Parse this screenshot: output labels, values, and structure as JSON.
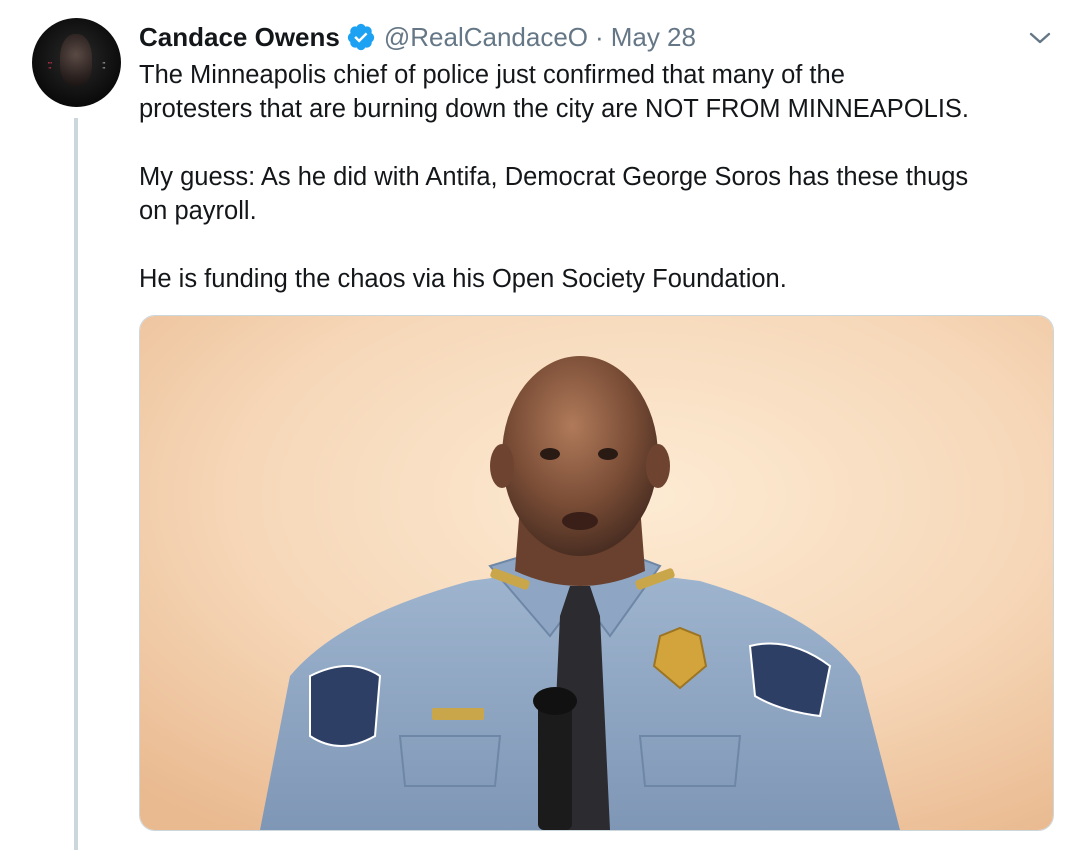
{
  "tweet": {
    "author_name": "Candace Owens",
    "handle": "@RealCandaceO",
    "separator": "·",
    "date": "May 28",
    "paragraphs": [
      "The Minneapolis chief of police just confirmed that many of the\nprotesters that are burning down the city are NOT FROM MINNEAPOLIS.",
      "My guess: As he did with Antifa, Democrat George Soros has these thugs\non payroll.",
      "He is funding the chaos via his Open Society Foundation."
    ]
  },
  "icons": {
    "verified": "verified-badge-icon",
    "caret": "chevron-down-icon"
  },
  "colors": {
    "text_primary": "#14171a",
    "text_secondary": "#657786",
    "verified_blue": "#1da1f2",
    "thread_line": "#ccd6dd",
    "media_border": "#ccd6dd"
  },
  "media": {
    "type": "photo",
    "description_visible": false
  }
}
